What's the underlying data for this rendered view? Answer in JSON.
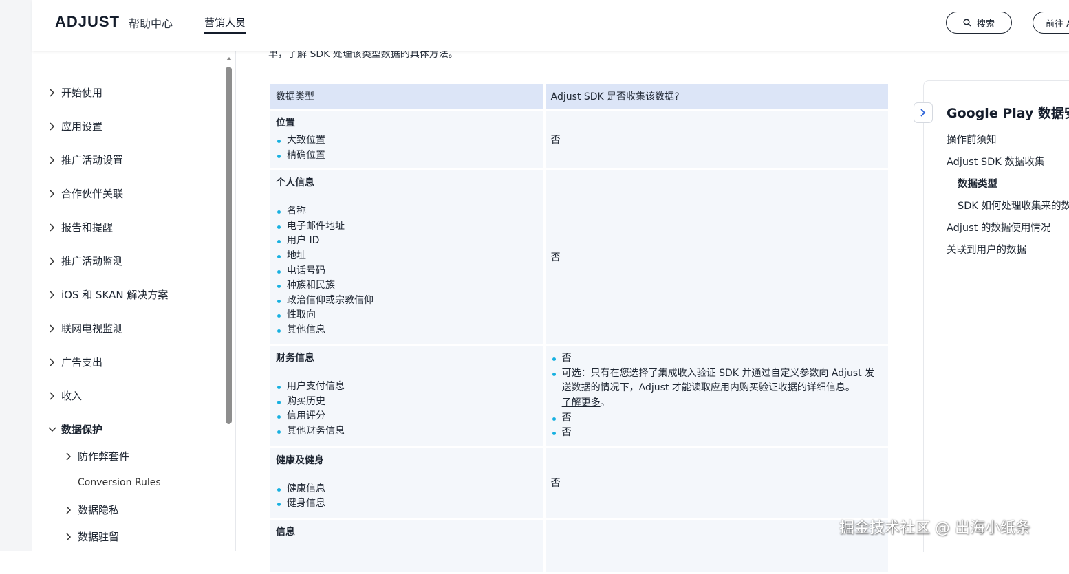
{
  "header": {
    "logo_text": "ADJUST",
    "help_center": "帮助中心",
    "audience_tab": "营销人员",
    "search_label": "搜索",
    "goto_label": "前往 A"
  },
  "sidebar": {
    "items": [
      {
        "label": "开始使用"
      },
      {
        "label": "应用设置"
      },
      {
        "label": "推广活动设置"
      },
      {
        "label": "合作伙伴关联"
      },
      {
        "label": "报告和提醒"
      },
      {
        "label": "推广活动监测"
      },
      {
        "label": "iOS 和 SKAN 解决方案"
      },
      {
        "label": "联网电视监测"
      },
      {
        "label": "广告支出"
      },
      {
        "label": "收入"
      },
      {
        "label": "数据保护"
      }
    ],
    "sub_items": [
      {
        "label": "防作弊套件"
      },
      {
        "label": "Conversion Rules"
      },
      {
        "label": "数据隐私"
      },
      {
        "label": "数据驻留"
      }
    ]
  },
  "main": {
    "intro_text": "单，了解 SDK 处理该类型数据的具体方法。",
    "table": {
      "headers": [
        "数据类型",
        "Adjust SDK 是否收集该数据?"
      ],
      "rows": [
        {
          "category": "位置",
          "items": [
            "大致位置",
            "精确位置"
          ],
          "answer": "否"
        },
        {
          "category": "个人信息",
          "items": [
            "名称",
            "电子邮件地址",
            "用户 ID",
            "地址",
            "电话号码",
            "种族和民族",
            "政治信仰或宗教信仰",
            "性取向",
            "其他信息"
          ],
          "answer": "否"
        },
        {
          "category": "财务信息",
          "items": [
            "用户支付信息",
            "购买历史",
            "信用评分",
            "其他财务信息"
          ],
          "answers": [
            "否",
            "可选：只有在您选择了集成收入验证 SDK 并通过自定义参数向 Adjust 发送数据的情况下，Adjust 才能读取应用内购买验证收据的详细信息。",
            "否",
            "否"
          ],
          "learn_more": "了解更多",
          "period": "。"
        },
        {
          "category": "健康及健身",
          "items": [
            "健康信息",
            "健身信息"
          ],
          "answer": "否"
        },
        {
          "category": "信息",
          "items": [],
          "answer": ""
        }
      ]
    }
  },
  "toc": {
    "title": "Google Play 数据安全",
    "items": [
      {
        "label": "操作前须知"
      },
      {
        "label": "Adjust SDK 数据收集"
      },
      {
        "label": "数据类型"
      },
      {
        "label": "SDK 如何处理收集来的数据"
      },
      {
        "label": "Adjust 的数据使用情况"
      },
      {
        "label": "关联到用户的数据"
      }
    ]
  },
  "watermark": "掘金技术社区 @ 出海小纸条",
  "colors": {
    "accent": "#17b0e0",
    "header_cell": "#dce5f7",
    "body_cell": "#f4f7fb"
  }
}
